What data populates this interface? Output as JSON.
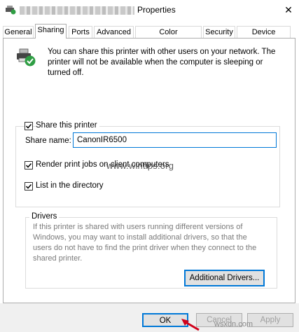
{
  "window": {
    "title": "Properties",
    "close_glyph": "✕"
  },
  "tabs": [
    {
      "label": "General"
    },
    {
      "label": "Sharing"
    },
    {
      "label": "Ports"
    },
    {
      "label": "Advanced"
    },
    {
      "label": "Color Management"
    },
    {
      "label": "Security"
    },
    {
      "label": "Device Settings"
    }
  ],
  "active_tab": "Sharing",
  "sharing": {
    "info_text": "You can share this printer with other users on your network. The printer will not be available when the computer is sleeping or turned off.",
    "share_printer_label": "Share this printer",
    "share_printer_checked": true,
    "share_name_label": "Share name:",
    "share_name_value": "CanonIR6500",
    "render_jobs_label": "Render print jobs on client computers",
    "render_jobs_checked": true,
    "list_directory_label": "List in the directory",
    "list_directory_checked": true
  },
  "drivers": {
    "title": "Drivers",
    "text": "If this printer is shared with users running different versions of Windows, you may want to install additional drivers, so that the users do not have to find the print driver when they connect to the shared printer.",
    "button_label": "Additional Drivers..."
  },
  "footer": {
    "ok_label": "OK",
    "cancel_label": "Cancel",
    "apply_label": "Apply"
  },
  "watermarks": {
    "center": "www.wintips.org",
    "corner": "wsxdn.com"
  },
  "colors": {
    "accent": "#0078d7",
    "arrow": "#d0021b",
    "share_badge": "#2f9e44"
  },
  "icons": {
    "app": "printer-share-icon",
    "printer": "printer-share-icon",
    "close": "close-icon",
    "checkbox": "checkmark-icon"
  }
}
